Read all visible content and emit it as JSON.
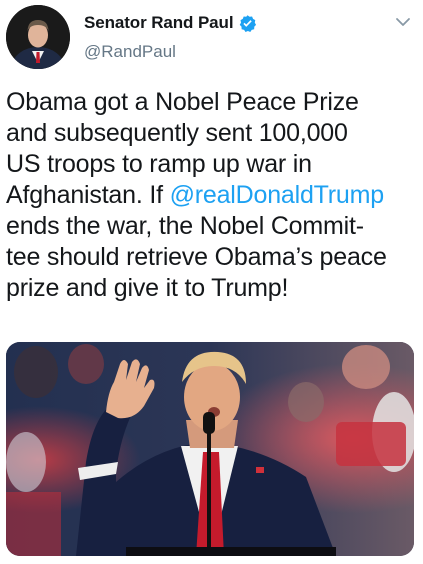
{
  "tweet": {
    "author": {
      "display_name": "Senator Rand Paul",
      "handle": "@RandPaul",
      "verified": true,
      "avatar_icon": "avatar-photo"
    },
    "menu_icon": "chevron-down-icon",
    "text": {
      "line1": "Obama got a Nobel Peace Prize",
      "line2": "and subsequently sent 100,000",
      "line3": "US troops to ramp up war in",
      "line4_before": "Afghanistan. If ",
      "mention": "@realDonaldTrump",
      "line5": "ends the war, the Nobel Commit-",
      "line6": "tee should retrieve Obama’s peace",
      "line7": "prize and give it to Trump!"
    },
    "media": {
      "description_icon": "photo-trump-rally"
    },
    "colors": {
      "link": "#1da1f2",
      "verified": "#1da1f2",
      "secondary_text": "#657786",
      "primary_text": "#14171a"
    }
  }
}
